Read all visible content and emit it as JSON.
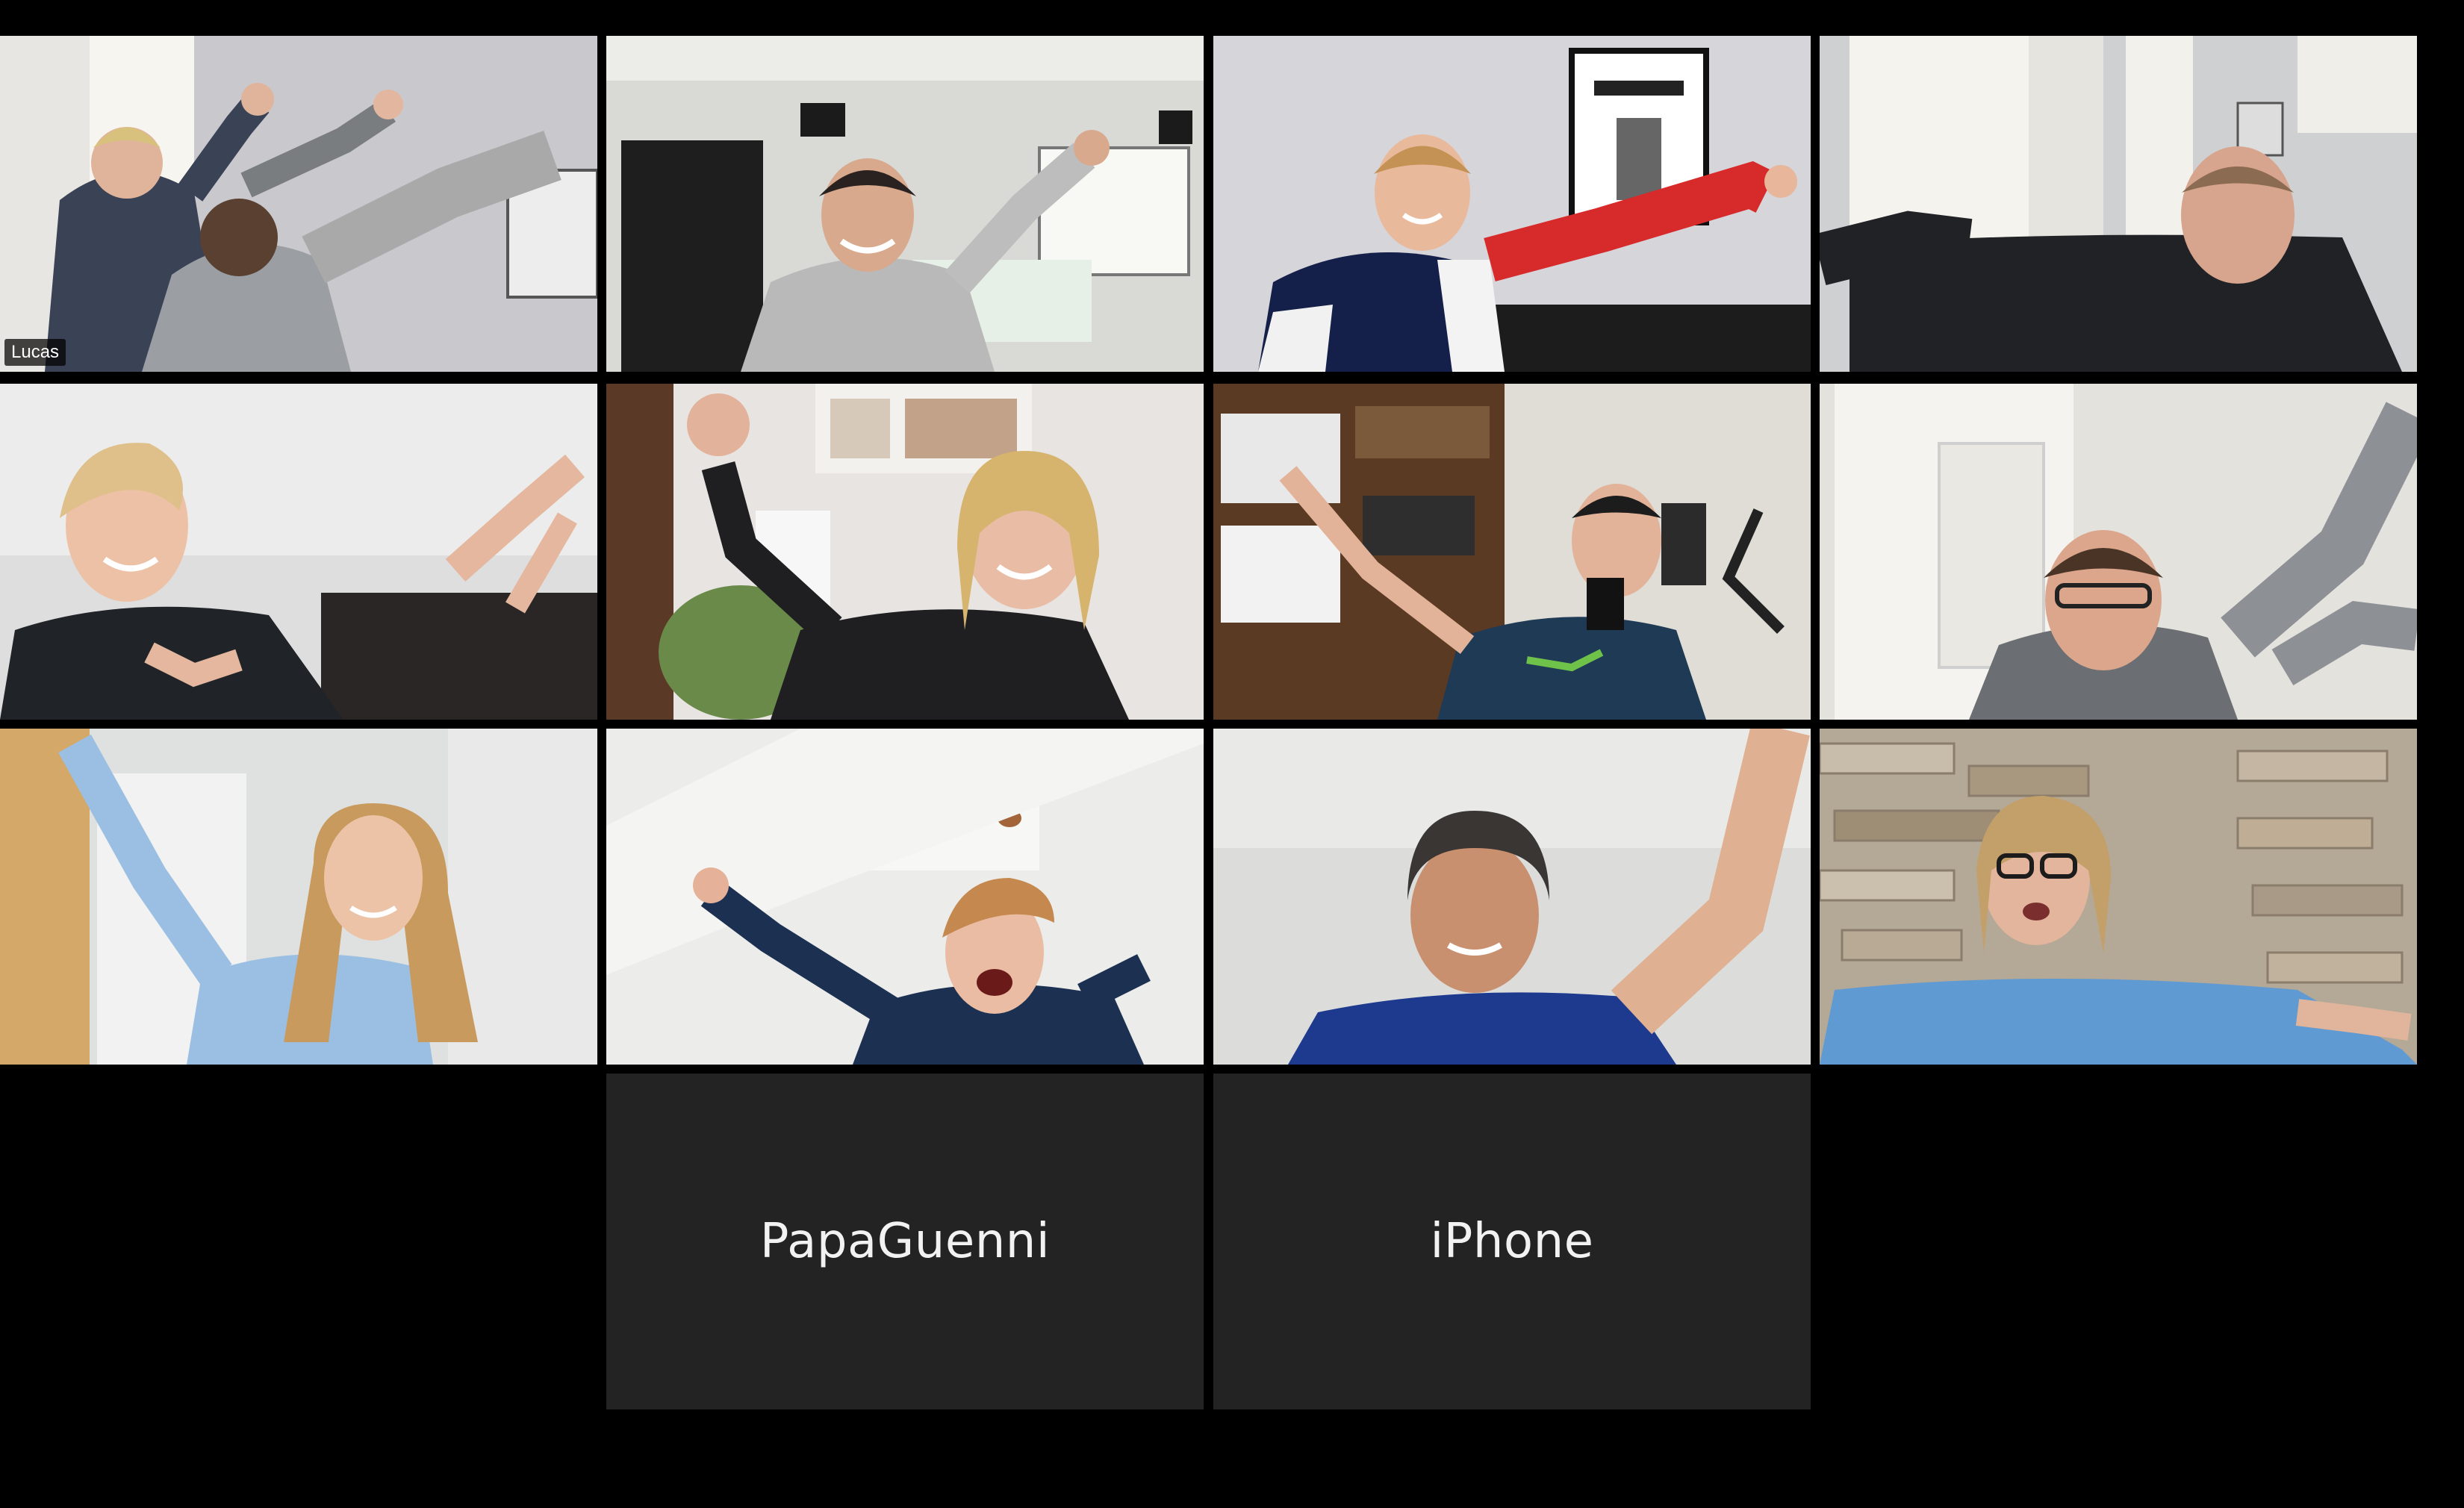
{
  "meeting": {
    "view": "gallery-view",
    "active_speaker": "Lucas"
  },
  "participants": [
    {
      "name": "Lucas",
      "video": "on",
      "show_label": true
    },
    {
      "name": "",
      "video": "on"
    },
    {
      "name": "",
      "video": "on"
    },
    {
      "name": "",
      "video": "on"
    },
    {
      "name": "",
      "video": "on"
    },
    {
      "name": "",
      "video": "on"
    },
    {
      "name": "",
      "video": "on"
    },
    {
      "name": "",
      "video": "on"
    },
    {
      "name": "",
      "video": "on"
    },
    {
      "name": "",
      "video": "on"
    },
    {
      "name": "",
      "video": "on"
    },
    {
      "name": "",
      "video": "on"
    },
    {
      "name": "PapaGuenni",
      "video": "off"
    },
    {
      "name": "iPhone",
      "video": "off"
    }
  ],
  "colors": {
    "background": "#000000",
    "active_speaker_border": "#d6e26e",
    "video_off_tile": "#232323",
    "video_off_text": "#f2f2f2"
  }
}
